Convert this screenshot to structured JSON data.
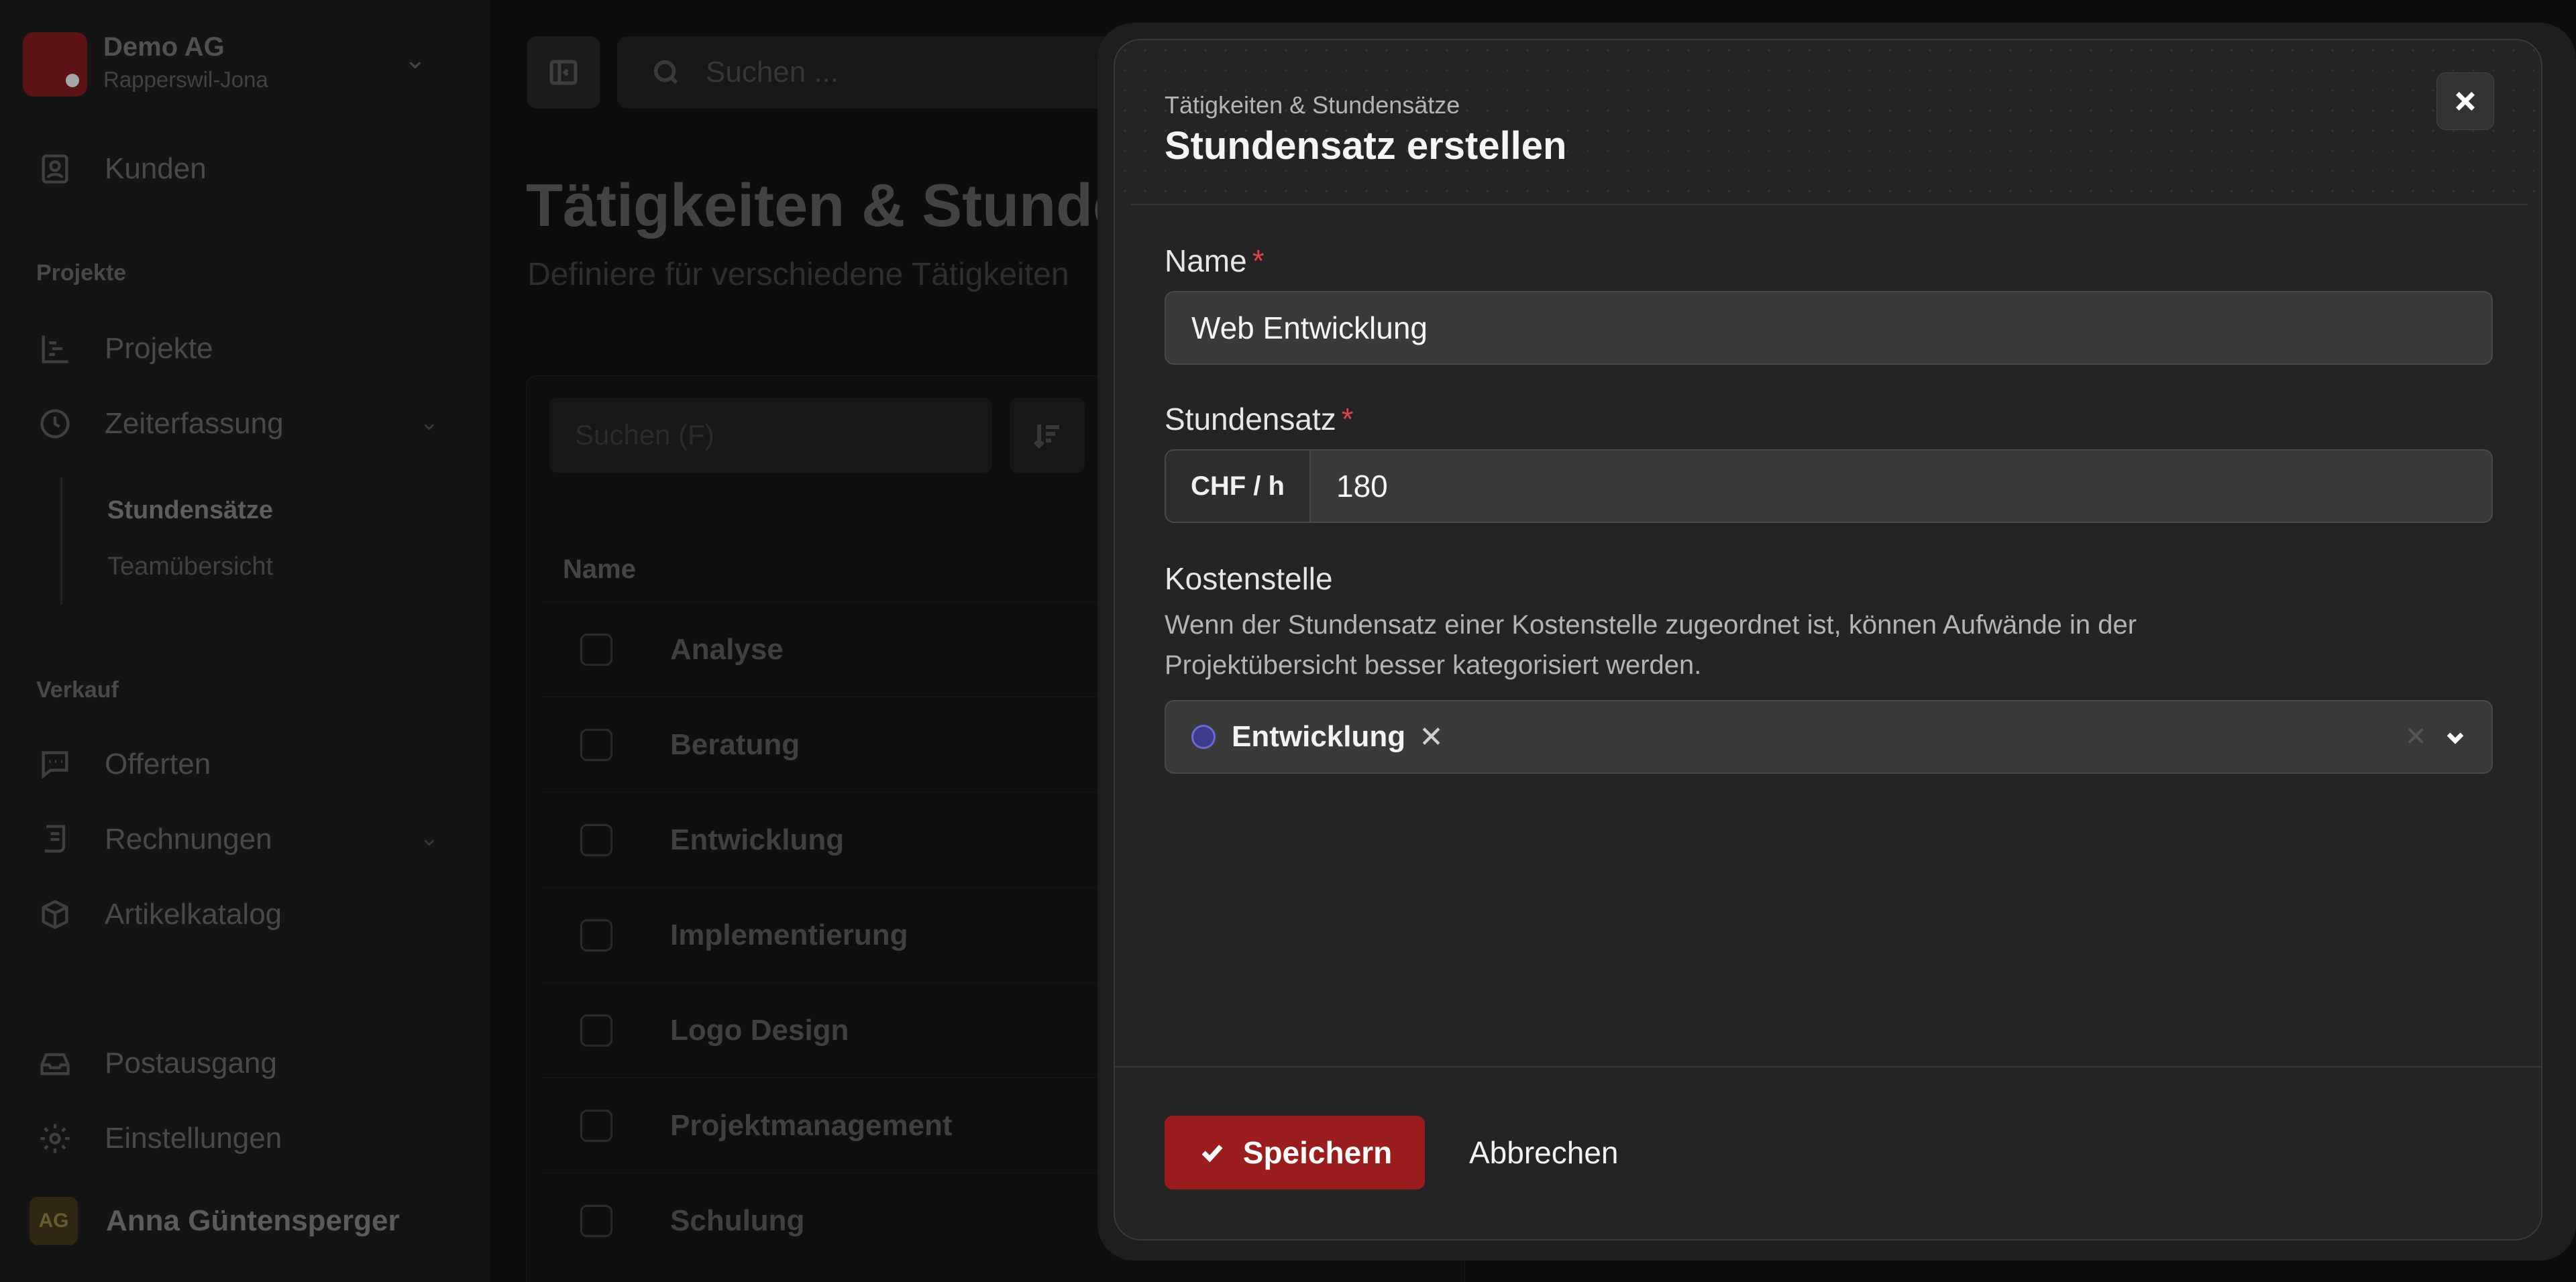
{
  "org": {
    "name": "Demo AG",
    "location": "Rapperswil-Jona"
  },
  "sidebar": {
    "customers": "Kunden",
    "section_projects": "Projekte",
    "projects": "Projekte",
    "time_tracking": "Zeiterfassung",
    "sub_rates": "Stundensätze",
    "sub_team": "Teamübersicht",
    "section_sales": "Verkauf",
    "offers": "Offerten",
    "invoices": "Rechnungen",
    "catalog": "Artikelkatalog",
    "outbox": "Postausgang",
    "settings": "Einstellungen"
  },
  "user": {
    "initials": "AG",
    "name": "Anna Güntensperger"
  },
  "topbar": {
    "search_placeholder": "Suchen ..."
  },
  "page": {
    "title": "Tätigkeiten & Stundensätze",
    "description": "Definiere für verschiedene Tätigkeiten",
    "filter_placeholder": "Suchen (F)",
    "column_name": "Name",
    "rows": [
      "Analyse",
      "Beratung",
      "Entwicklung",
      "Implementierung",
      "Logo Design",
      "Projektmanagement",
      "Schulung"
    ]
  },
  "modal": {
    "supertitle": "Tätigkeiten & Stundensätze",
    "title": "Stundensatz erstellen",
    "name_label": "Name",
    "name_value": "Web Entwicklung",
    "rate_label": "Stundensatz",
    "rate_addon": "CHF / h",
    "rate_value": "180",
    "cost_label": "Kostenstelle",
    "cost_help": "Wenn der Stundensatz einer Kostenstelle zugeordnet ist, können Aufwände in der Projektübersicht besser kategorisiert werden.",
    "cost_tag": "Entwicklung",
    "save_label": "Speichern",
    "cancel_label": "Abbrechen",
    "required_mark": "*",
    "tag_color": "#6b68d8",
    "accent": "#9b1c1c"
  }
}
